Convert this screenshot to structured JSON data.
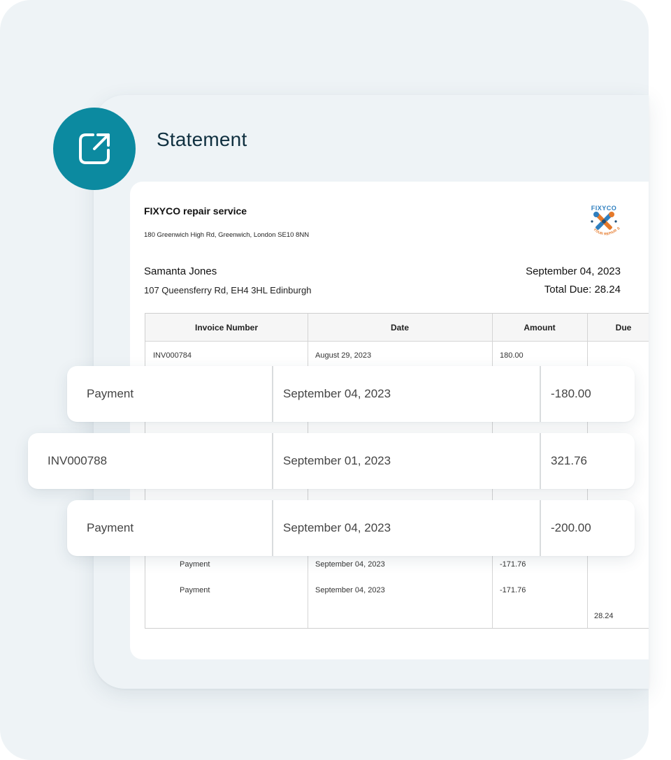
{
  "header": {
    "title": "Statement",
    "share_icon": "share-external-icon"
  },
  "document": {
    "company_name": "FIXYCO repair service",
    "company_address": "180 Greenwich High Rd, Greenwich, London SE10 8NN",
    "logo": {
      "top_text": "FIXYCO",
      "bottom_text": "YOUR REPAIR SERVICE",
      "icon": "crossed-tools-icon"
    },
    "customer_name": "Samanta Jones",
    "customer_address": "107 Queensferry Rd, EH4 3HL Edinburgh",
    "statement_date": "September 04, 2023",
    "total_due": "Total Due: 28.24",
    "table": {
      "headers": [
        "Invoice Number",
        "Date",
        "Amount",
        "Due"
      ],
      "rows": [
        {
          "invoice": "INV000784",
          "date": "August 29, 2023",
          "amount": "180.00",
          "due": ""
        },
        {
          "invoice": "Payment",
          "date": "September 04, 2023",
          "amount": "-171.76",
          "due": ""
        },
        {
          "invoice": "Payment",
          "date": "September 04, 2023",
          "amount": "-171.76",
          "due": ""
        }
      ],
      "final_due": "28.24"
    }
  },
  "highlighted_rows": [
    {
      "label": "Payment",
      "date": "September 04, 2023",
      "amount": "-180.00"
    },
    {
      "label": "INV000788",
      "date": "September 01, 2023",
      "amount": "321.76"
    },
    {
      "label": "Payment",
      "date": "September 04, 2023",
      "amount": "-200.00"
    }
  ],
  "colors": {
    "accent": "#0c8aa0",
    "panel_background": "#eef3f6",
    "title_text": "#103040"
  }
}
